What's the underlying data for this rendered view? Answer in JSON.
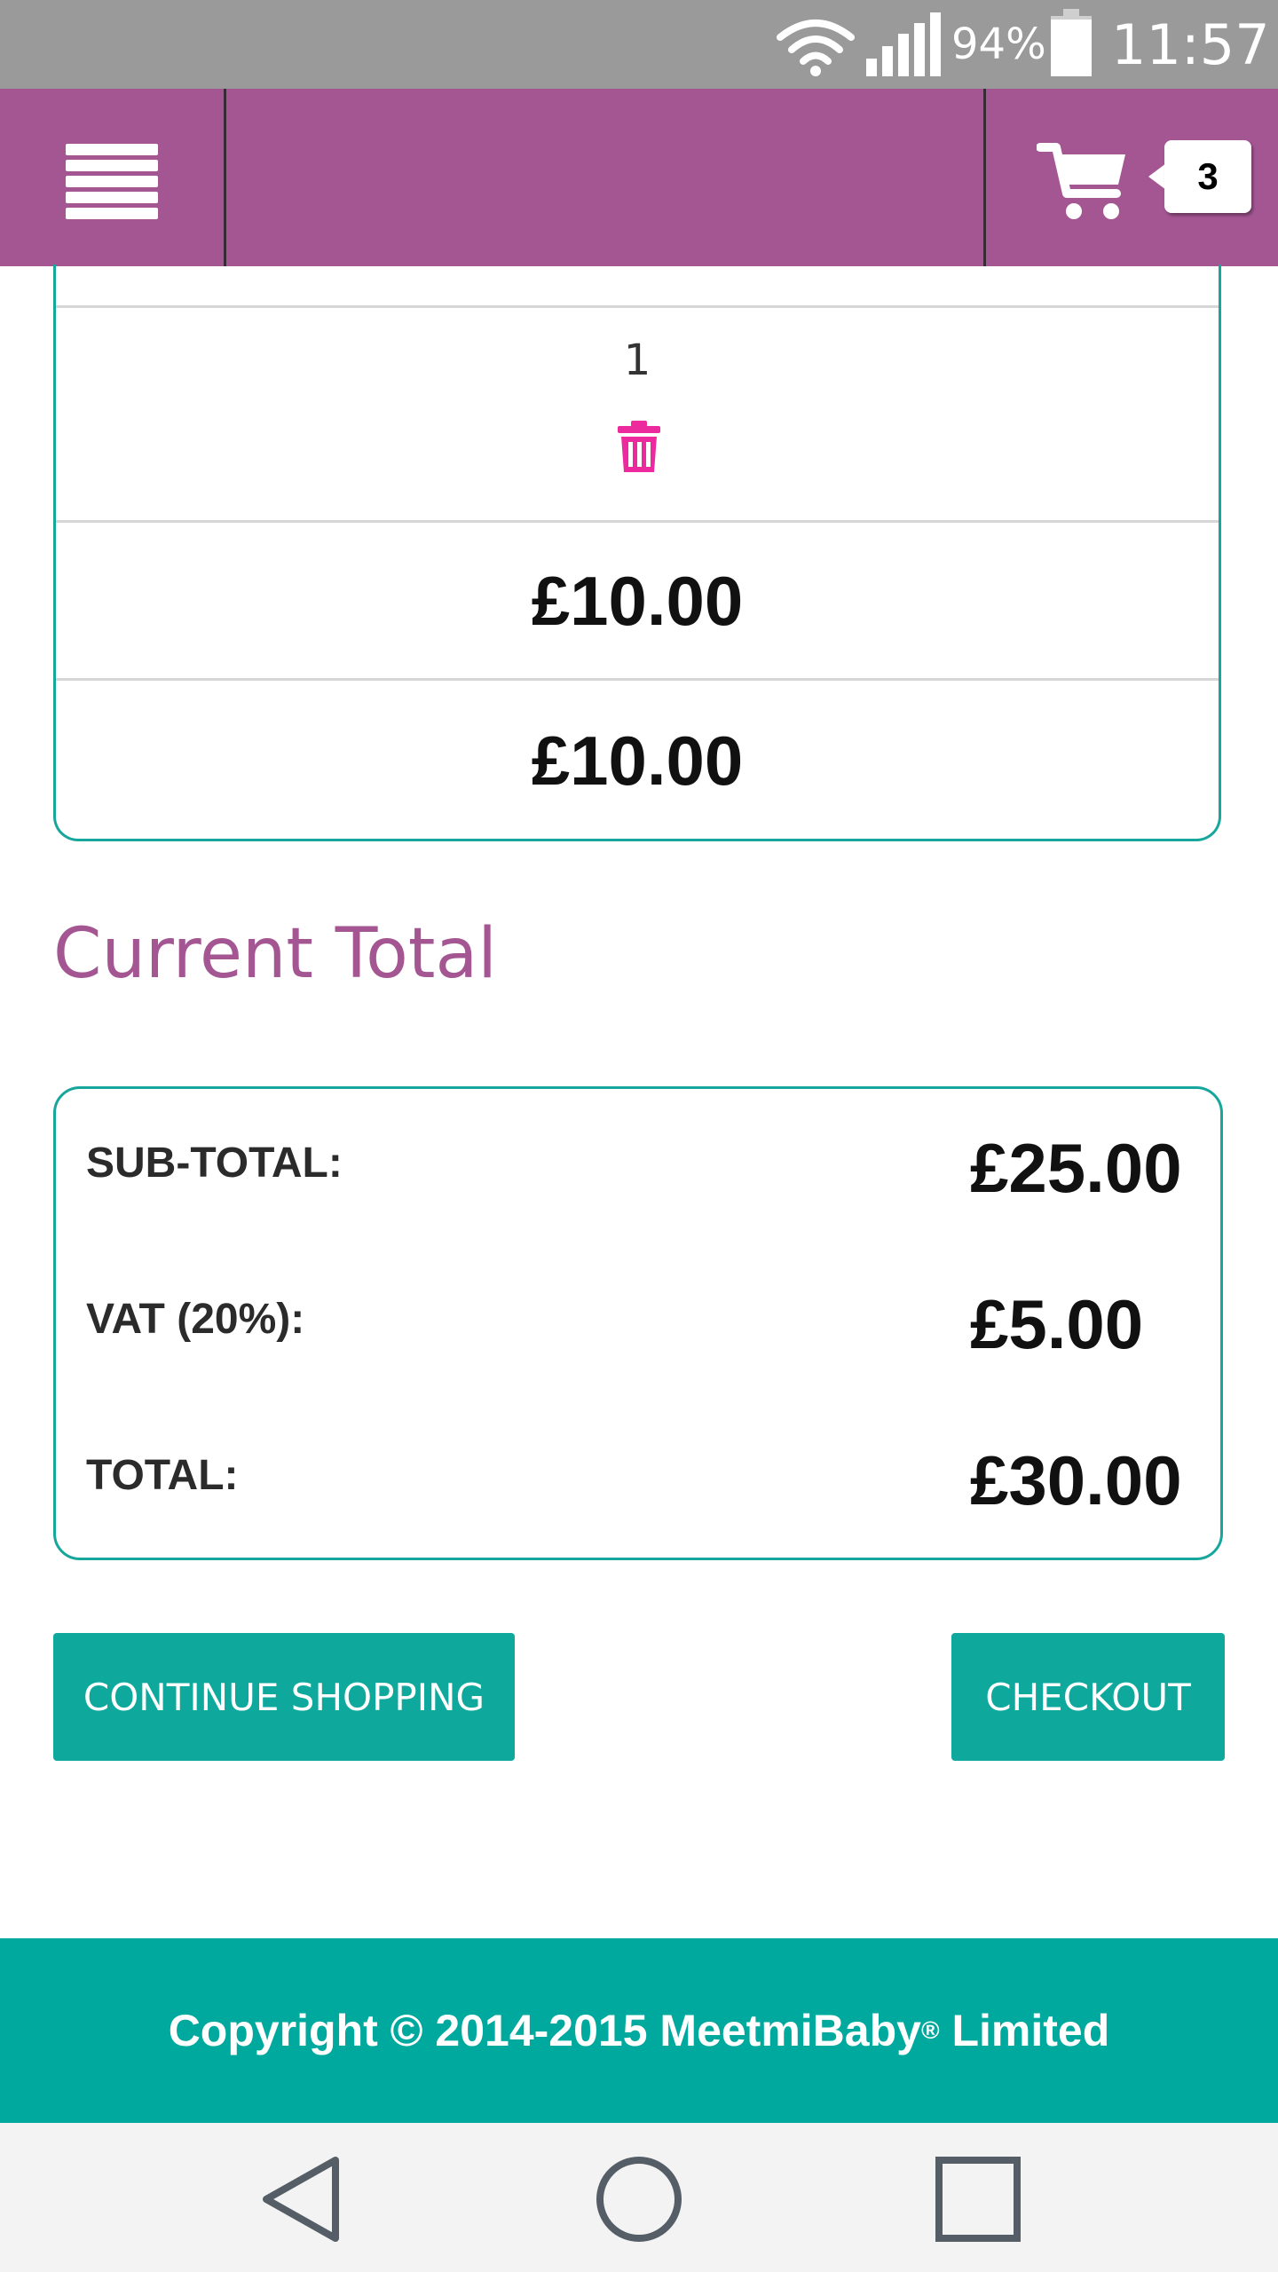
{
  "status_bar": {
    "battery": "94%",
    "time": "11:57",
    "icons": [
      "wifi-icon",
      "signal-icon",
      "battery-icon"
    ]
  },
  "header": {
    "cart_count": "3",
    "icons": [
      "hamburger-menu-icon",
      "shopping-cart-icon"
    ]
  },
  "item_card": {
    "quantity": "1",
    "unit_price": "£10.00",
    "line_total": "£10.00",
    "icons": [
      "trash-icon"
    ]
  },
  "current_total": {
    "title": "Current Total",
    "rows": [
      {
        "label": "SUB-TOTAL:",
        "value": "£25.00"
      },
      {
        "label": "VAT (20%):",
        "value": "£5.00"
      },
      {
        "label": "TOTAL:",
        "value": "£30.00"
      }
    ]
  },
  "actions": {
    "continue_label": "CONTINUE SHOPPING",
    "checkout_label": "CHECKOUT"
  },
  "footer": {
    "copyright": "Copyright © 2014-2015 MeetmiBaby",
    "registered": "®",
    "suffix": " Limited"
  },
  "nav_bar": {
    "icons": [
      "back-icon",
      "home-icon",
      "recents-icon"
    ]
  },
  "colors": {
    "brand_purple": "#a45693",
    "teal": "#0ea89c",
    "trash_pink": "#ec2a9d"
  }
}
